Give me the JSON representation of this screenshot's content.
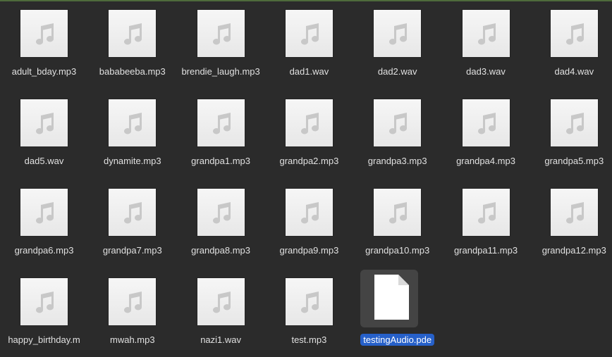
{
  "files": [
    {
      "name": "adult_bday.mp3",
      "icon": "music-note-icon"
    },
    {
      "name": "bababeeba.mp3",
      "icon": "music-note-icon"
    },
    {
      "name": "brendie_laugh.mp3",
      "icon": "music-note-icon"
    },
    {
      "name": "dad1.wav",
      "icon": "music-note-icon"
    },
    {
      "name": "dad2.wav",
      "icon": "music-note-icon"
    },
    {
      "name": "dad3.wav",
      "icon": "music-note-icon"
    },
    {
      "name": "dad4.wav",
      "icon": "music-note-icon"
    },
    {
      "name": "dad5.wav",
      "icon": "music-note-icon"
    },
    {
      "name": "dynamite.mp3",
      "icon": "music-note-icon"
    },
    {
      "name": "grandpa1.mp3",
      "icon": "music-note-icon"
    },
    {
      "name": "grandpa2.mp3",
      "icon": "music-note-icon"
    },
    {
      "name": "grandpa3.mp3",
      "icon": "music-note-icon"
    },
    {
      "name": "grandpa4.mp3",
      "icon": "music-note-icon"
    },
    {
      "name": "grandpa5.mp3",
      "icon": "music-note-icon"
    },
    {
      "name": "grandpa6.mp3",
      "icon": "music-note-icon"
    },
    {
      "name": "grandpa7.mp3",
      "icon": "music-note-icon"
    },
    {
      "name": "grandpa8.mp3",
      "icon": "music-note-icon"
    },
    {
      "name": "grandpa9.mp3",
      "icon": "music-note-icon"
    },
    {
      "name": "grandpa10.mp3",
      "icon": "music-note-icon"
    },
    {
      "name": "grandpa11.mp3",
      "icon": "music-note-icon"
    },
    {
      "name": "grandpa12.mp3",
      "icon": "music-note-icon"
    },
    {
      "name": "happy_birthday.m",
      "icon": "music-note-icon"
    },
    {
      "name": "mwah.mp3",
      "icon": "music-note-icon"
    },
    {
      "name": "nazi1.wav",
      "icon": "music-note-icon"
    },
    {
      "name": "test.mp3",
      "icon": "music-note-icon"
    },
    {
      "name": "testingAudio.pde",
      "icon": "document-icon",
      "selected": true
    }
  ],
  "colors": {
    "background": "#2b2b2b",
    "selection": "#2660c9",
    "label_text": "#e0e0e0"
  }
}
